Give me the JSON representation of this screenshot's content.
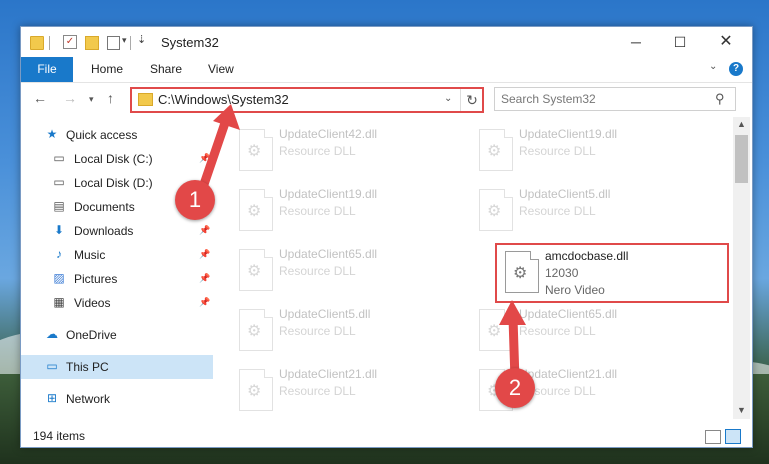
{
  "window": {
    "title": "System32",
    "controls": {
      "minimize": "─",
      "maximize": "☐",
      "close": "✕"
    }
  },
  "ribbon": {
    "tabs": [
      "File",
      "Home",
      "Share",
      "View"
    ]
  },
  "nav": {
    "address": "C:\\Windows\\System32",
    "search_placeholder": "Search System32"
  },
  "sidebar": {
    "items": [
      {
        "label": "Quick access",
        "icon": "star-icon"
      },
      {
        "label": "Local Disk (C:)",
        "icon": "drive-icon"
      },
      {
        "label": "Local Disk (D:)",
        "icon": "drive-icon"
      },
      {
        "label": "Documents",
        "icon": "documents-icon"
      },
      {
        "label": "Downloads",
        "icon": "download-icon"
      },
      {
        "label": "Music",
        "icon": "music-icon"
      },
      {
        "label": "Pictures",
        "icon": "pictures-icon"
      },
      {
        "label": "Videos",
        "icon": "videos-icon"
      },
      {
        "label": "OneDrive",
        "icon": "cloud-icon"
      },
      {
        "label": "This PC",
        "icon": "computer-icon"
      },
      {
        "label": "Network",
        "icon": "network-icon"
      }
    ]
  },
  "files": [
    {
      "name": "UpdateClient42.dll",
      "type": "Resource DLL"
    },
    {
      "name": "UpdateClient19.dll",
      "type": "Resource DLL"
    },
    {
      "name": "UpdateClient19.dll",
      "type": "Resource DLL"
    },
    {
      "name": "UpdateClient5.dll",
      "type": "Resource DLL"
    },
    {
      "name": "UpdateClient65.dll",
      "type": "Resource DLL"
    },
    {
      "name": "amcdocbase.dll",
      "type": "12030",
      "company": "Nero Video"
    },
    {
      "name": "UpdateClient5.dll",
      "type": "Resource DLL"
    },
    {
      "name": "UpdateClient65.dll",
      "type": "Resource DLL"
    },
    {
      "name": "UpdateClient21.dll",
      "type": "Resource DLL"
    },
    {
      "name": "UpdateClient21.dll",
      "type": "Resource DLL"
    }
  ],
  "status": {
    "items_count": "194 items"
  },
  "callouts": [
    "1",
    "2"
  ],
  "colors": {
    "accent": "#1979ca",
    "callout": "#e24848",
    "selection": "#cce4f7"
  }
}
